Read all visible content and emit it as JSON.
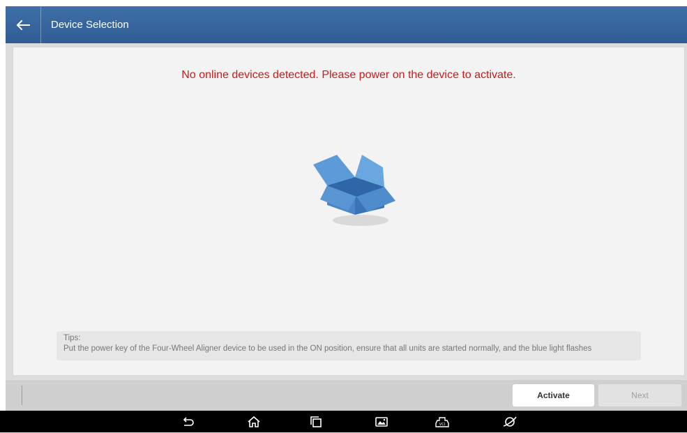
{
  "header": {
    "title": "Device Selection",
    "back_icon": "arrow-left-icon"
  },
  "main": {
    "message": "No online devices detected. Please power on the device to activate.",
    "illustration_icon": "open-box-icon",
    "tips": {
      "heading": "Tips:",
      "text": "Put the power key of the Four-Wheel Aligner device to be used in the ON position, ensure that all units are started normally, and the blue light flashes"
    }
  },
  "footer": {
    "activate_label": "Activate",
    "next_label": "Next"
  },
  "system_nav": {
    "icons": [
      "back-icon",
      "home-icon",
      "recent-apps-icon",
      "screenshot-icon",
      "vci-icon",
      "browser-icon"
    ]
  },
  "colors": {
    "header_bg": "#3a679f",
    "message_red": "#c91b1b",
    "box_blue": "#4a86c8"
  }
}
